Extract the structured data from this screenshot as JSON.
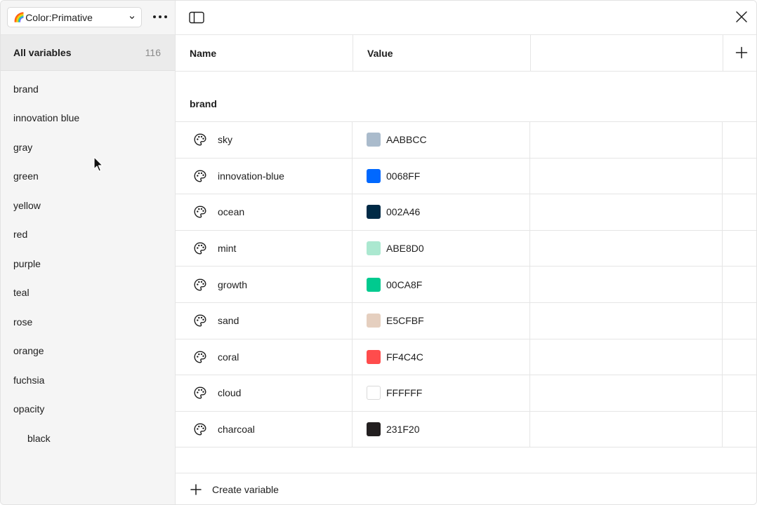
{
  "collection": {
    "emoji": "🌈",
    "name": "Color:Primative"
  },
  "sidebar": {
    "all_variables_label": "All variables",
    "all_variables_count": "116",
    "groups": [
      {
        "label": "brand"
      },
      {
        "label": "innovation blue"
      },
      {
        "label": "gray"
      },
      {
        "label": "green"
      },
      {
        "label": "yellow"
      },
      {
        "label": "red"
      },
      {
        "label": "purple"
      },
      {
        "label": "teal"
      },
      {
        "label": "rose"
      },
      {
        "label": "orange"
      },
      {
        "label": "fuchsia"
      },
      {
        "label": "opacity"
      },
      {
        "label": "black"
      }
    ]
  },
  "table": {
    "headers": {
      "name": "Name",
      "value": "Value"
    },
    "group_title": "brand",
    "rows": [
      {
        "name": "sky",
        "hex": "AABBCC",
        "color": "#AABBCC"
      },
      {
        "name": "innovation-blue",
        "hex": "0068FF",
        "color": "#0068FF"
      },
      {
        "name": "ocean",
        "hex": "002A46",
        "color": "#002A46"
      },
      {
        "name": "mint",
        "hex": "ABE8D0",
        "color": "#ABE8D0"
      },
      {
        "name": "growth",
        "hex": "00CA8F",
        "color": "#00CA8F"
      },
      {
        "name": "sand",
        "hex": "E5CFBF",
        "color": "#E5CFBF"
      },
      {
        "name": "coral",
        "hex": "FF4C4C",
        "color": "#FF4C4C"
      },
      {
        "name": "cloud",
        "hex": "FFFFFF",
        "color": "#FFFFFF"
      },
      {
        "name": "charcoal",
        "hex": "231F20",
        "color": "#231F20"
      }
    ]
  },
  "footer": {
    "create_label": "Create variable"
  },
  "icons": {
    "collection_chevron": "chevron-down-icon",
    "more": "more-icon",
    "panel_toggle": "sidebar-toggle-icon",
    "close": "close-icon",
    "add_column": "plus-icon",
    "variable_type": "palette-icon",
    "create": "plus-icon",
    "cursor": "cursor-icon"
  }
}
